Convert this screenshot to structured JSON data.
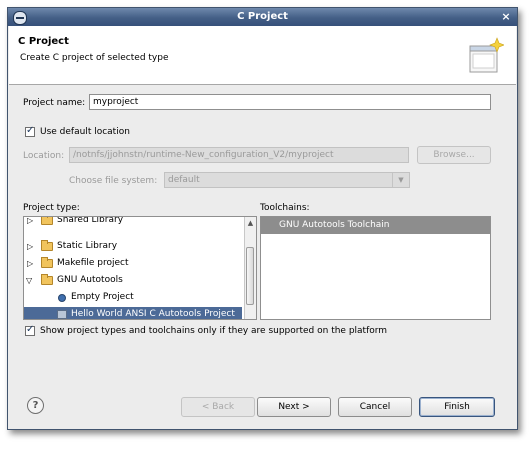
{
  "window": {
    "title": "C Project",
    "close_glyph": "×"
  },
  "header": {
    "title": "C Project",
    "description": "Create C project of selected type"
  },
  "project_name": {
    "label": "Project name:",
    "value": "myproject"
  },
  "use_default_location": {
    "label": "Use default location",
    "checked": true
  },
  "location": {
    "label": "Location:",
    "value": "/notnfs/jjohnstn/runtime-New_configuration_V2/myproject",
    "browse_label": "Browse..."
  },
  "file_system": {
    "label": "Choose file system:",
    "value": "default"
  },
  "project_type": {
    "label": "Project type:",
    "items": [
      {
        "label": "Shared Library",
        "icon": "folder-icon",
        "expander": "collapsed"
      },
      {
        "label": "Static Library",
        "icon": "folder-icon",
        "expander": "collapsed"
      },
      {
        "label": "Makefile project",
        "icon": "folder-icon",
        "expander": "collapsed"
      },
      {
        "label": "GNU Autotools",
        "icon": "folder-icon",
        "expander": "expanded"
      },
      {
        "label": "Empty Project",
        "icon": "project-dot-icon"
      },
      {
        "label": "Hello World ANSI C Autotools Project",
        "icon": "project-icon",
        "selected": true
      }
    ]
  },
  "toolchains": {
    "label": "Toolchains:",
    "items": [
      {
        "label": "GNU Autotools Toolchain",
        "selected": true
      }
    ]
  },
  "filter_option": {
    "label": "Show project types and toolchains only if they are supported on the platform",
    "checked": true
  },
  "buttons": {
    "back": "< Back",
    "next": "Next >",
    "cancel": "Cancel",
    "finish": "Finish",
    "help": "?"
  },
  "colors": {
    "title_bar": "#445f86",
    "selection": "#4c6a97",
    "toolchain_selection": "#8d8d8d",
    "dialog_bg": "#ececec"
  }
}
